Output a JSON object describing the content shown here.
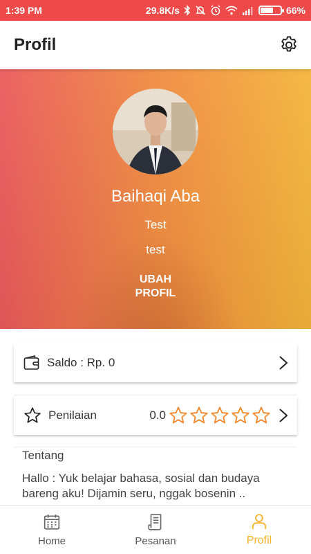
{
  "status_bar": {
    "time": "1:39 PM",
    "net_speed": "29.8K/s",
    "battery_percent": "66%",
    "battery_level": 0.66
  },
  "app_bar": {
    "title": "Profil"
  },
  "profile": {
    "name": "Baihaqi Aba",
    "line1": "Test",
    "line2": "test",
    "edit_label_line1": "UBAH",
    "edit_label_line2": "PROFIL"
  },
  "saldo": {
    "label": "Saldo : Rp. 0"
  },
  "rating": {
    "label": "Penilaian",
    "value": "0.0",
    "stars_filled": 0,
    "stars_total": 5
  },
  "about": {
    "heading": "Tentang",
    "text": "Hallo : Yuk belajar bahasa, sosial dan budaya bareng aku! Dijamin seru, nggak bosenin .."
  },
  "bottom_nav": {
    "items": [
      {
        "label": "Home",
        "icon": "calendar-icon"
      },
      {
        "label": "Pesanan",
        "icon": "receipt-icon"
      },
      {
        "label": "Profil",
        "icon": "person-icon"
      }
    ],
    "active": "Profil"
  },
  "colors": {
    "status_bar": "#ee4a4a",
    "gradient_start": "#ea5a5a",
    "gradient_end": "#f5b43a",
    "accent": "#f6b32a",
    "star": "#f08a2e"
  }
}
